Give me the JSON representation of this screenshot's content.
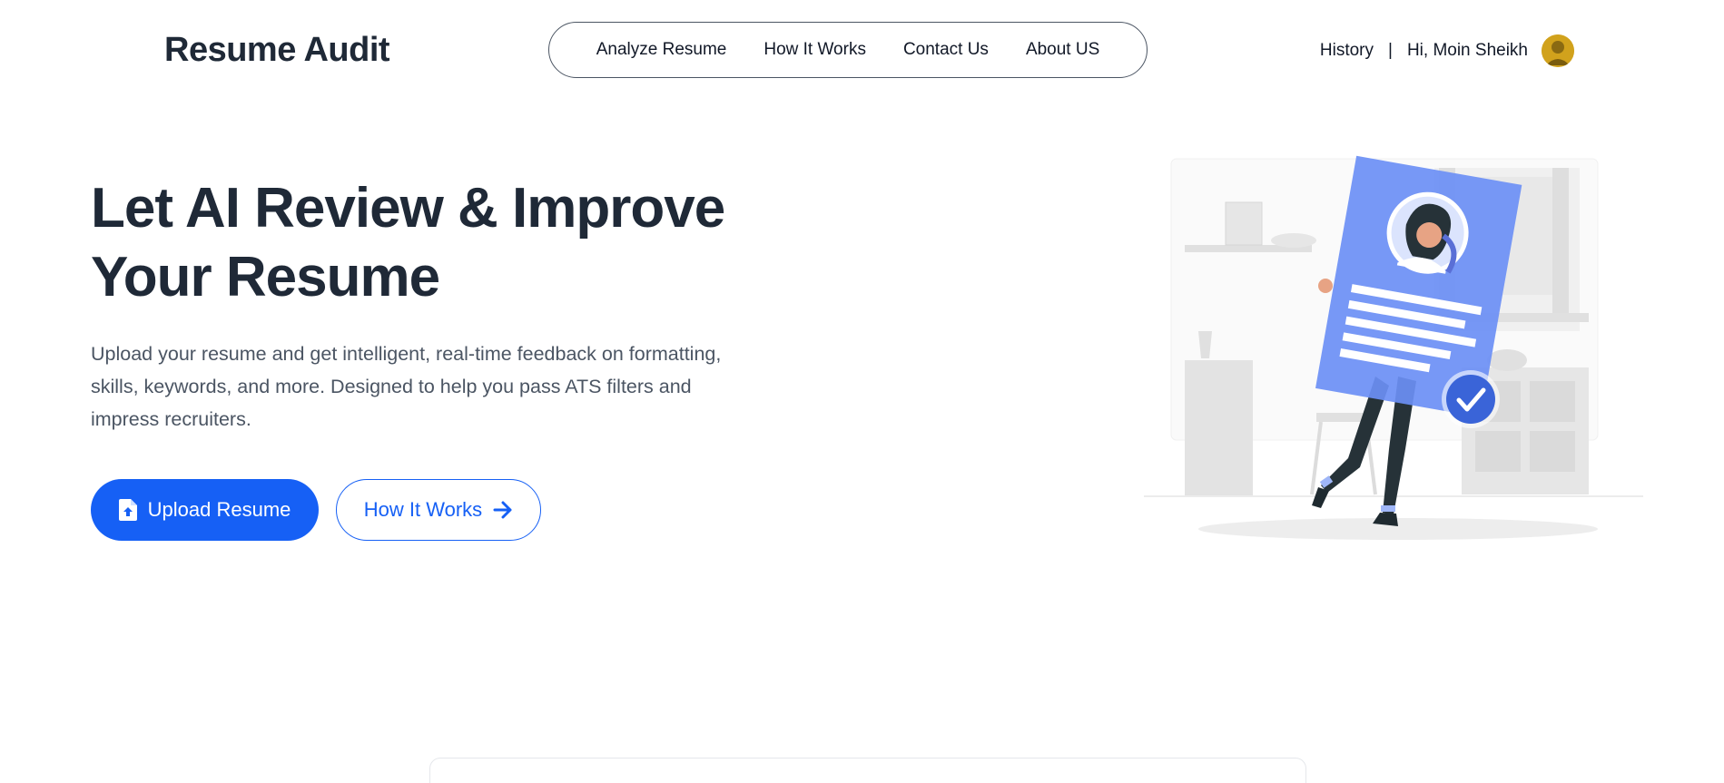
{
  "brand": {
    "name": "Resume Audit"
  },
  "nav": {
    "links": [
      {
        "label": "Analyze Resume"
      },
      {
        "label": "How It Works"
      },
      {
        "label": "Contact Us"
      },
      {
        "label": "About US"
      }
    ]
  },
  "user_nav": {
    "history_label": "History",
    "separator": "|",
    "greeting": "Hi, Moin Sheikh"
  },
  "hero": {
    "title_line1": "Let AI Review & Improve",
    "title_line2": "Your Resume",
    "description": "Upload your resume and get intelligent, real-time feedback on formatting, skills, keywords, and more. Designed to help you pass ATS filters and impress recruiters.",
    "primary_button": {
      "label": "Upload Resume",
      "icon": "file-upload-icon"
    },
    "secondary_button": {
      "label": "How It Works",
      "icon": "arrow-right-icon"
    }
  },
  "colors": {
    "accent": "#1660f5",
    "heading": "#1f2937",
    "body_text": "#4b5563",
    "illustration_blue": "#6b8ff5"
  }
}
